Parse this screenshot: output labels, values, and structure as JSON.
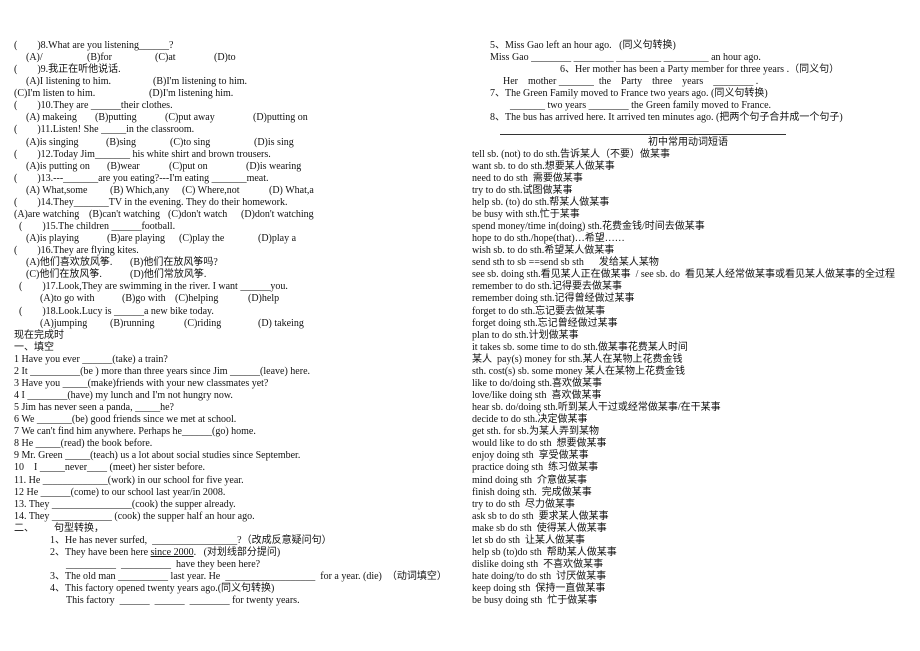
{
  "left": {
    "lines": [
      {
        "q": "(        )8.What are you listening______?",
        "opts": [
          "(A)/",
          "(B)for",
          "(C)at",
          "(D)to"
        ]
      },
      {
        "q": "(        )9.我正在听他说话.",
        "opts": [
          "(A)I listening to him.",
          "(B)I'm listening to him."
        ]
      },
      {
        "opts": [
          "(C)I'm listen to him.",
          "(D)I'm listening him."
        ]
      },
      {
        "q": "(        )10.They are ______their clothes.",
        "opts": [
          "(A) makeing",
          "(B)putting",
          "(C)put away",
          "(D)putting on"
        ]
      },
      {
        "q": "(        )11.Listen! She _____in the classroom.",
        "opts": [
          "(A)is singing",
          "(B)sing",
          "(C)to sing",
          "(D)is sing"
        ]
      },
      {
        "q": "(        )12.Today Jim_______ his white shirt and brown trousers.",
        "opts": [
          "(A)is putting on",
          "(B)wear",
          "(C)put on",
          "(D)is wearing"
        ]
      },
      {
        "q": "(        )13.---_______are you eating?---I'm eating _______meat.",
        "opts": [
          "(A) What,some",
          "(B) Which,any",
          "(C) Where,not",
          "(D) What,a"
        ]
      },
      {
        "q": "(        )14.They_______TV in the evening. They do their homework.",
        "opts": [
          "(A)are watching",
          "(B)can't watching",
          "(C)don't watch",
          "(D)don't watching"
        ]
      },
      {
        "q": "  (        )15.The children ______football.",
        "opts": [
          "(A)is playing",
          "(B)are playing",
          "(C)play the",
          "(D)play a"
        ]
      },
      {
        "q": "(        )16.They are flying kites.",
        "opts": [
          "(A)他们喜欢放风筝.",
          "(B)他们在放风筝吗?"
        ]
      },
      {
        "opts": [
          "(C)他们在放风筝.",
          "(D)他们常放风筝."
        ]
      },
      {
        "q": "  (        )17.Look,They are swimming in the river. I want ______you.",
        "opts": [
          "(A)to go with",
          "(B)go with",
          "(C)helping",
          "(D)help"
        ]
      },
      {
        "q": "  (        )18.Look.Lucy is ______a new bike today.",
        "opts": [
          "(A)jumping",
          "(B)running",
          "(C)riding",
          "(D) takeing"
        ]
      }
    ],
    "section_title": "现在完成时",
    "fill_title": "一、填空",
    "fill": [
      "1 Have you ever ______(take) a train?",
      "2 It __________(be ) more than three years since Jim ______(leave) here.",
      "3 Have you _____(make)friends with your new classmates yet?",
      "4 I ________(have) my lunch and I'm not hungry now.",
      "5 Jim has never seen a panda, _____he?",
      "6 We _______(be) good friends since we met at school.",
      "7 We can't find him anywhere. Perhaps he______(go) home.",
      "8 He _____(read) the book before.",
      "9 Mr. Green _____(teach) us a lot about social studies since September.",
      "10    I _____never____ (meet) her sister before.",
      "11. He _____________(work) in our school for five year.",
      "12 He ______(come) to our school last year/in 2008.",
      "13. They ________________(cook) the supper already.",
      "14. They ____________ (cook) the supper half an hour ago."
    ],
    "transform_title": "二、        句型转换，",
    "t1": "1、He has never surfed,  _________________?（改成反意疑问句）",
    "t2_pre": "2、They have been here ",
    "t2_ul": "since 2000",
    "t2_post": ".   (对划线部分提问)",
    "t2_blank": "__________  __________  have they been here?",
    "t3": "3、The old man __________ last year. He  __________________  for a year. (die)  （动词填空）",
    "t4": "4、This factory opened twenty years ago.(同义句转换)",
    "t4_blank": "This factory  ______  ______  ________ for twenty years."
  },
  "right": {
    "r5": "5、Miss Gao left an hour ago.   (同义句转换)",
    "r5_blank": "Miss Gao ________ ________ _________ _________ an hour ago.",
    "r6": "6、Her mother has been a Party member for three years .（同义句）",
    "r6_blank": "Her    mother _______  the    Party    three    years    ________ .",
    "r7": "7、The Green Family moved to France two years ago. (同义句转换)",
    "r7_blank": "_______ two years ________ the Green family moved to France.",
    "r8": "8、The bus has arrived here. It arrived ten minutes ago. (把两个句子合并成一个句子)",
    "phrases_title": "初中常用动词短语",
    "phrases": [
      "tell sb. (not) to do sth.告诉某人（不要）做某事",
      "want sb. to do sth.想要某人做某事",
      "need to do sth  需要做某事",
      "try to do sth.试图做某事",
      "help sb. (to) do sth.帮某人做某事",
      "be busy with sth.忙于某事",
      "spend money/time in(doing) sth.花费金钱/时间去做某事",
      "hope to do sth./hope(that)…希望……",
      "wish sb. to do sth.希望某人做某事",
      "send sth to sb ==send sb sth      发给某人某物",
      "see sb. doing sth.看见某人正在做某事  / see sb. do  看见某人经常做某事或看见某人做某事的全过程",
      "remember to do sth.记得要去做某事",
      "remember doing sth.记得曾经做过某事",
      "forget to do sth.忘记要去做某事",
      "forget doing sth.忘记曾经做过某事",
      "plan to do sth.计划做某事",
      "it takes sb. some time to do sth.做某事花费某人时间",
      "某人  pay(s) money for sth.某人在某物上花费金钱",
      "sth. cost(s) sb. some money 某人在某物上花费金钱",
      "like to do/doing sth.喜欢做某事",
      "love/like doing sth  喜欢做某事",
      "hear sb. do/doing sth.听到某人干过或经常做某事/在干某事",
      "decide to do sth.决定做某事",
      "get sth. for sb.为某人弄到某物",
      "would like to do sth  想要做某事",
      "enjoy doing sth  享受做某事",
      "practice doing sth  练习做某事",
      "mind doing sth  介意做某事",
      "finish doing sth.  完成做某事",
      "try to do sth  尽力做某事",
      "ask sb to do sth  要求某人做某事",
      "make sb do sth  使得某人做某事",
      "let sb do sth  让某人做某事",
      "help sb (to)do sth  帮助某人做某事",
      "dislike doing sth  不喜欢做某事",
      "hate doing/to do sth  讨厌做某事",
      "keep doing sth  保持一直做某事",
      "be busy doing sth  忙于做某事"
    ]
  }
}
